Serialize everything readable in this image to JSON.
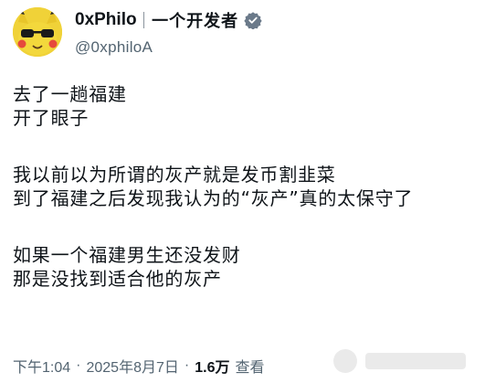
{
  "tweet": {
    "author": {
      "display_name": "0xPhilo",
      "org": "一个开发者",
      "handle": "@0xphiloA",
      "verified": true,
      "avatar_icon": "pikachu-avatar",
      "verified_icon": "verified-badge-icon"
    },
    "lines": [
      "去了一趟福建",
      "开了眼子",
      "",
      "我以前以为所谓的灰产就是发币割韭菜",
      "到了福建之后发现我认为的“灰产”真的太保守了",
      "",
      "如果一个福建男生还没发财",
      "那是没找到适合他的灰产"
    ],
    "meta": {
      "time": "下午1:04",
      "date": "2025年8月7日",
      "separator": "·",
      "views_count": "1.6万",
      "views_label": "查看"
    }
  },
  "colors": {
    "text": "#0f1419",
    "secondary": "#536471",
    "verified": "#6b7a8a",
    "avatar_bg": "#f0d238"
  }
}
